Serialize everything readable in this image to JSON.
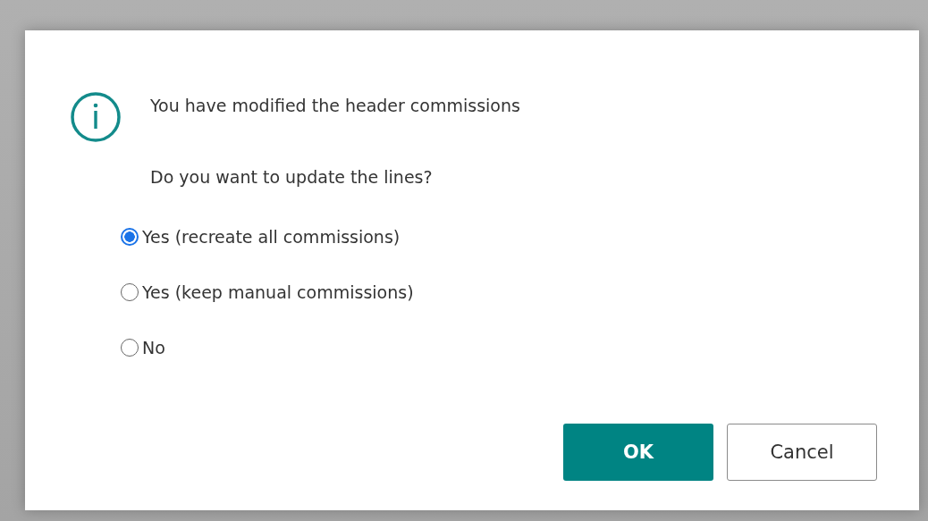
{
  "dialog": {
    "messages": [
      "You have modified the header commissions",
      "Do you want to update the lines?"
    ],
    "options": [
      {
        "label": "Yes (recreate all commissions)",
        "selected": true
      },
      {
        "label": "Yes (keep manual commissions)",
        "selected": false
      },
      {
        "label": "No",
        "selected": false
      }
    ],
    "buttons": [
      {
        "label": "OK",
        "kind": "primary"
      },
      {
        "label": "Cancel",
        "kind": "secondary"
      }
    ]
  }
}
